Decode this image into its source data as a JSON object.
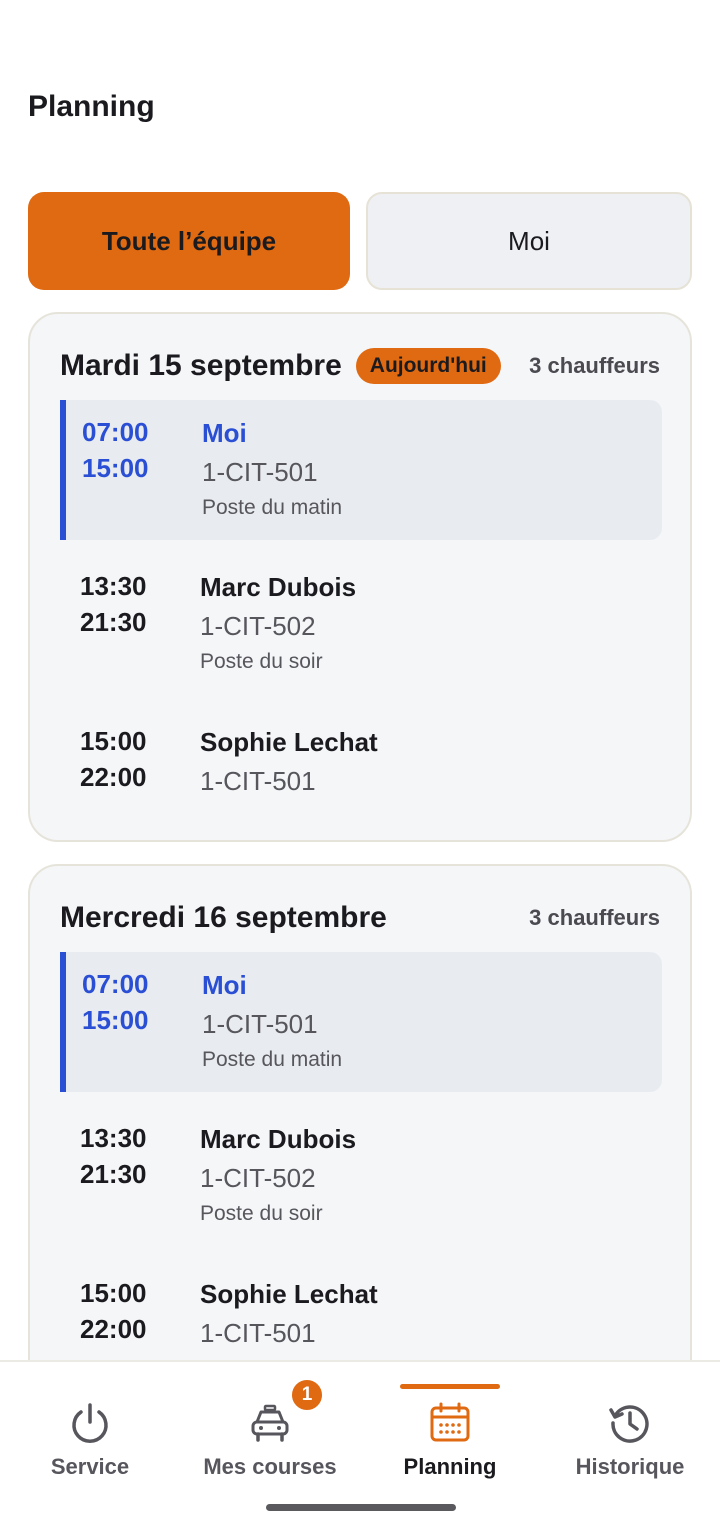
{
  "page": {
    "title": "Planning"
  },
  "filters": {
    "team_label": "Toute l’équipe",
    "me_label": "Moi",
    "selected": "team"
  },
  "days": [
    {
      "title": "Mardi 15 septembre",
      "badge": "Aujourd'hui",
      "count": "3 chauffeurs",
      "shifts": [
        {
          "start": "07:00",
          "end": "15:00",
          "name": "Moi",
          "plate": "1-CIT-501",
          "poste": "Poste du matin"
        },
        {
          "start": "13:30",
          "end": "21:30",
          "name": "Marc Dubois",
          "plate": "1-CIT-502",
          "poste": "Poste du soir"
        },
        {
          "start": "15:00",
          "end": "22:00",
          "name": "Sophie Lechat",
          "plate": "1-CIT-501",
          "poste": ""
        }
      ]
    },
    {
      "title": "Mercredi 16 septembre",
      "badge": "",
      "count": "3 chauffeurs",
      "shifts": [
        {
          "start": "07:00",
          "end": "15:00",
          "name": "Moi",
          "plate": "1-CIT-501",
          "poste": "Poste du matin"
        },
        {
          "start": "13:30",
          "end": "21:30",
          "name": "Marc Dubois",
          "plate": "1-CIT-502",
          "poste": "Poste du soir"
        },
        {
          "start": "15:00",
          "end": "22:00",
          "name": "Sophie Lechat",
          "plate": "1-CIT-501",
          "poste": ""
        }
      ]
    }
  ],
  "nav": {
    "items": [
      {
        "label": "Service",
        "icon": "power-icon"
      },
      {
        "label": "Mes courses",
        "icon": "car-icon",
        "badge": "1"
      },
      {
        "label": "Planning",
        "icon": "calendar-icon"
      },
      {
        "label": "Historique",
        "icon": "history-icon"
      }
    ],
    "active_index": 2
  },
  "colors": {
    "accent": "#e06a12",
    "me_highlight": "#2a4fd4",
    "card_bg": "#f5f6f8"
  }
}
